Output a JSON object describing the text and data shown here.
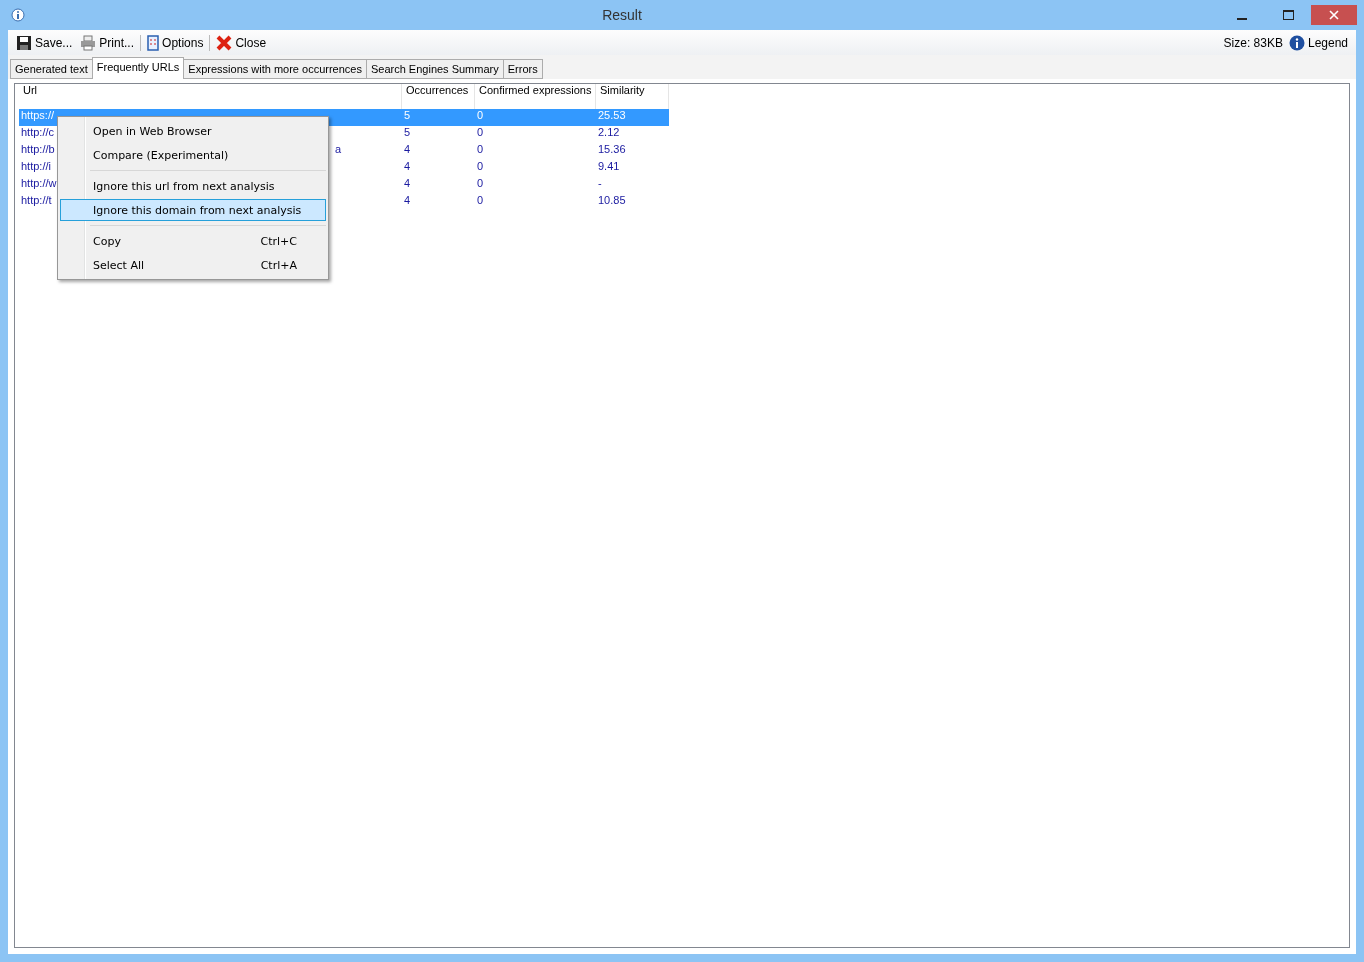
{
  "window": {
    "title": "Result"
  },
  "toolbar": {
    "items": [
      {
        "kind": "save",
        "label": "Save..."
      },
      {
        "kind": "print",
        "label": "Print..."
      },
      {
        "kind": "options",
        "label": "Options"
      },
      {
        "kind": "close",
        "label": "Close"
      }
    ],
    "size": "Size: 83KB",
    "legend": "Legend"
  },
  "tabs": [
    {
      "label": "Generated text",
      "selected": false
    },
    {
      "label": "Frequently URLs",
      "selected": true
    },
    {
      "label": "Expressions with more occurrences",
      "selected": false
    },
    {
      "label": "Search Engines Summary",
      "selected": false
    },
    {
      "label": "Errors",
      "selected": false
    }
  ],
  "table": {
    "columns": [
      "Url",
      "Occurrences",
      "Confirmed expressions",
      "Similarity"
    ],
    "rows": [
      {
        "url": "https://",
        "occurrences": "5",
        "confirmed": "0",
        "similarity": "25.53",
        "selected": true
      },
      {
        "url": "http://c",
        "occurrences": "5",
        "confirmed": "0",
        "similarity": "2.12",
        "selected": false
      },
      {
        "url": "http://b",
        "url_tail": "a",
        "occurrences": "4",
        "confirmed": "0",
        "similarity": "15.36",
        "selected": false
      },
      {
        "url": "http://i",
        "occurrences": "4",
        "confirmed": "0",
        "similarity": "9.41",
        "selected": false
      },
      {
        "url": "http://w",
        "occurrences": "4",
        "confirmed": "0",
        "similarity": "-",
        "selected": false
      },
      {
        "url": "http://t",
        "occurrences": "4",
        "confirmed": "0",
        "similarity": "10.85",
        "selected": false
      }
    ]
  },
  "context_menu": {
    "groups": [
      [
        {
          "label": "Open in Web Browser",
          "selected": false
        },
        {
          "label": "Compare (Experimental)",
          "selected": false
        }
      ],
      [
        {
          "label": "Ignore this url from next analysis",
          "selected": false
        },
        {
          "label": "Ignore this domain from next analysis",
          "selected": true
        }
      ],
      [
        {
          "label": "Copy",
          "shortcut": "Ctrl+C",
          "selected": false
        },
        {
          "label": "Select All",
          "shortcut": "Ctrl+A",
          "selected": false
        }
      ]
    ]
  }
}
